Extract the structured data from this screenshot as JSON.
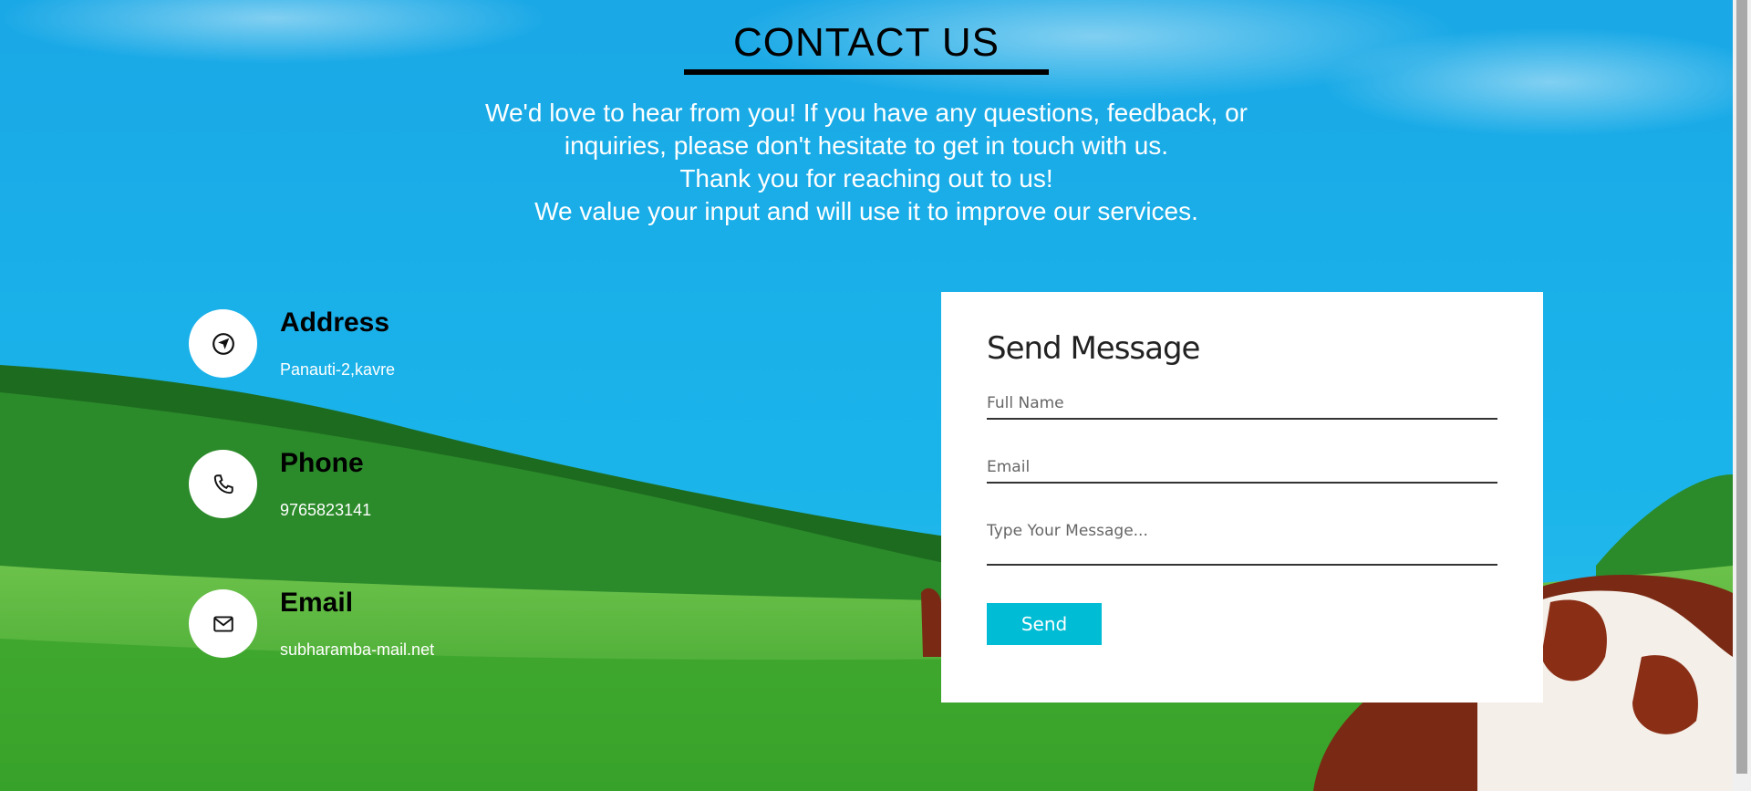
{
  "header": {
    "title": "CONTACT US",
    "intro_lines": [
      "We'd love to hear from you! If you have any questions, feedback, or",
      "inquiries, please don't hesitate to get in touch with us.",
      "Thank you for reaching out to us!",
      "We value your input and will use it to improve our services."
    ]
  },
  "contact_info": [
    {
      "label": "Address",
      "value": "Panauti-2,kavre",
      "icon": "navigation-icon"
    },
    {
      "label": "Phone",
      "value": "9765823141",
      "icon": "phone-icon"
    },
    {
      "label": "Email",
      "value": "subharamba-mail.net",
      "icon": "mail-icon"
    }
  ],
  "form": {
    "title": "Send Message",
    "full_name_placeholder": "Full Name",
    "email_placeholder": "Email",
    "message_placeholder": "Type Your Message...",
    "send_label": "Send"
  },
  "colors": {
    "accent": "#00bcd4",
    "sky": "#14b2e8",
    "grass": "#3fa42e"
  }
}
